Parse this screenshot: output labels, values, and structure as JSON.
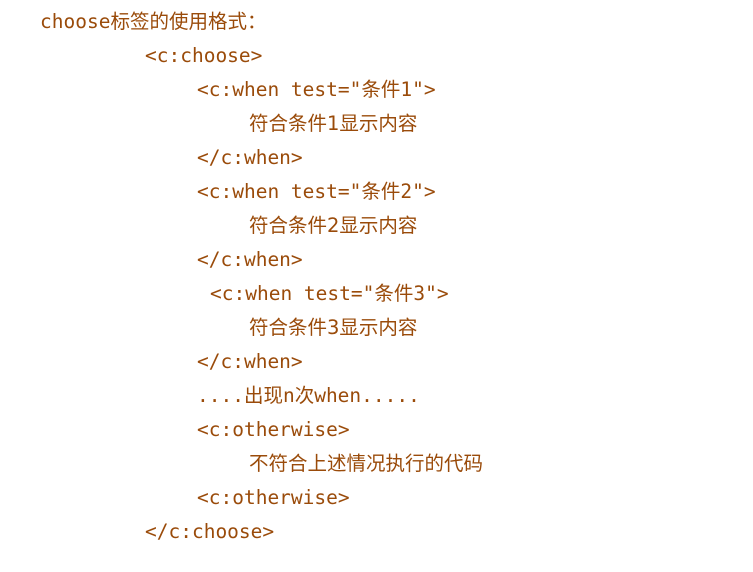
{
  "doc": {
    "heading": "choose标签的使用格式：",
    "lines": [
      "<c:choose>",
      "<c:when test=\"条件1\">",
      "符合条件1显示内容",
      "</c:when>",
      "<c:when test=\"条件2\">",
      "符合条件2显示内容",
      "</c:when>",
      "<c:when test=\"条件3\">",
      "符合条件3显示内容",
      "</c:when>",
      "....出现n次when.....",
      "<c:otherwise>",
      "不符合上述情况执行的代码",
      "<c:otherwise>",
      "</c:choose>"
    ]
  },
  "colors": {
    "text": "#9a4b0a",
    "background": "#ffffff"
  }
}
